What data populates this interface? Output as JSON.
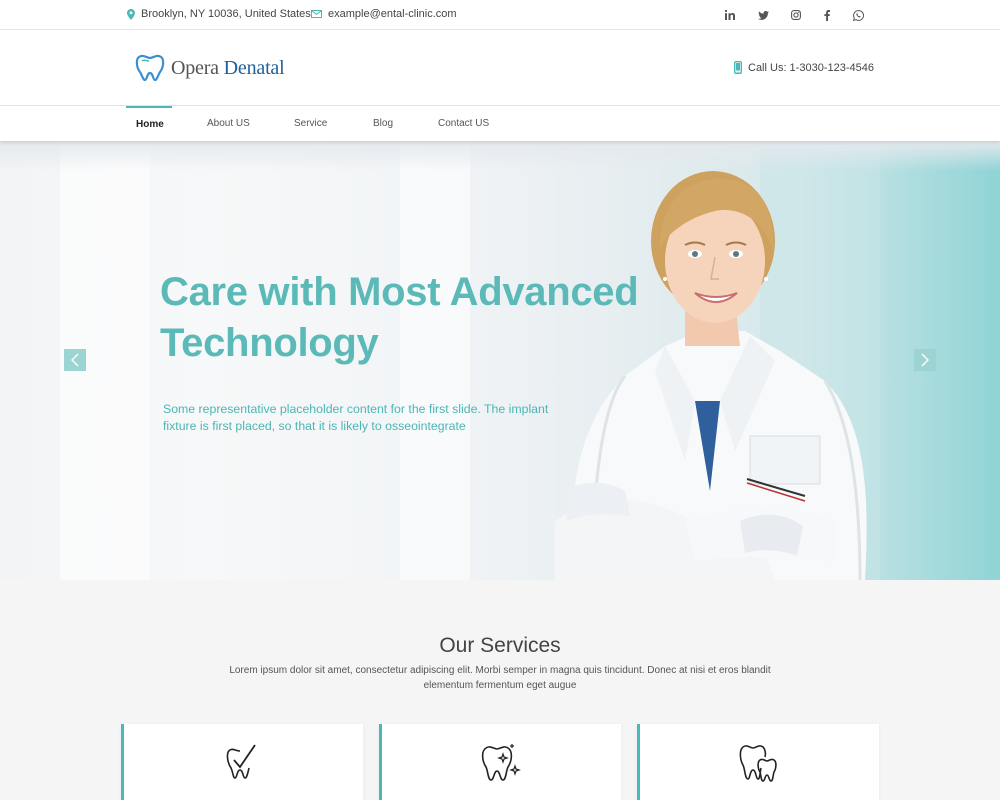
{
  "topbar": {
    "address": "Brooklyn, NY 10036, United States",
    "email": "example@ental-clinic.com",
    "social": [
      "linkedin-icon",
      "twitter-icon",
      "instagram-icon",
      "facebook-icon",
      "whatsapp-icon"
    ]
  },
  "header": {
    "logo_part1": "Opera",
    "logo_part2": "Denatal",
    "call": "Call Us: 1-3030-123-4546"
  },
  "nav": {
    "items": [
      {
        "label": "Home",
        "active": true
      },
      {
        "label": "About US"
      },
      {
        "label": "Service"
      },
      {
        "label": "Blog"
      },
      {
        "label": "Contact US"
      }
    ]
  },
  "hero": {
    "title_line1": "Care with Most Advanced",
    "title_line2": "Technology",
    "subtitle": "Some representative placeholder content for the first slide. The implant fixture is first placed, so that it is likely to osseointegrate"
  },
  "services": {
    "title": "Our Services",
    "description": "Lorem ipsum dolor sit amet, consectetur adipiscing elit. Morbi semper in magna quis tincidunt. Donec at nisi et eros blandit elementum fermentum eget augue",
    "cards": [
      "tooth-check-icon",
      "sparkling-tooth-icon",
      "double-tooth-icon"
    ]
  },
  "colors": {
    "accent": "#49b8b6",
    "hero_text": "#5bbab8",
    "logo_blue": "#1f5f9a"
  }
}
